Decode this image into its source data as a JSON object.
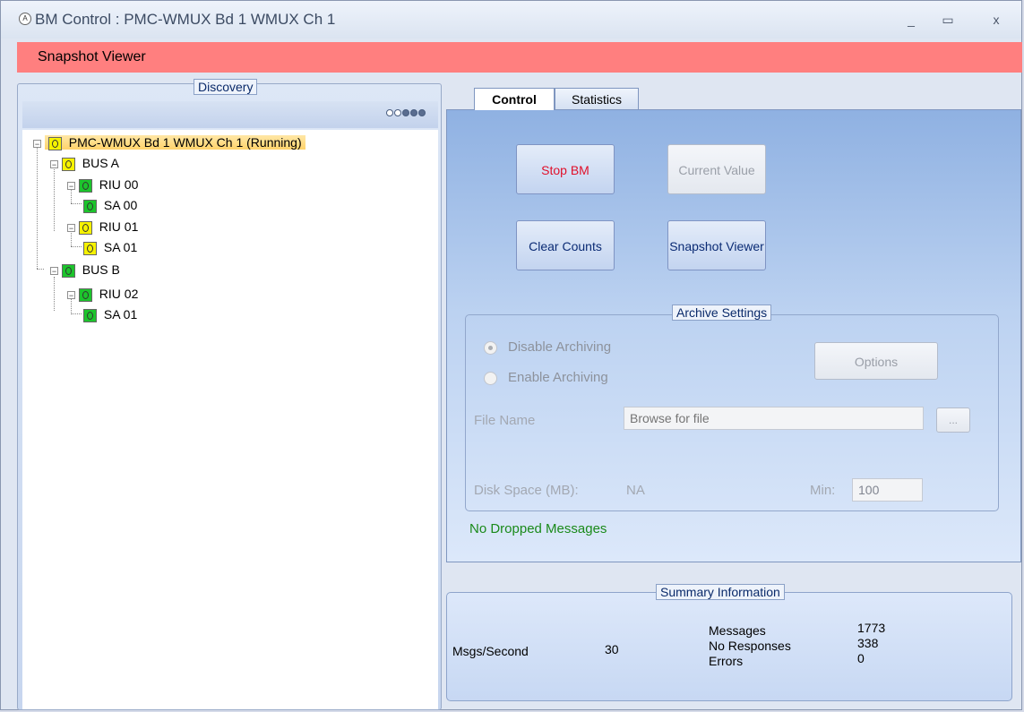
{
  "window": {
    "title": "BM Control : PMC-WMUX Bd 1 WMUX Ch 1",
    "icon": "app-icon",
    "min": "_",
    "max": "▭",
    "close": "x"
  },
  "menubar": {
    "label": "Snapshot Viewer"
  },
  "discovery": {
    "legend": "Discovery",
    "tree": {
      "root": "PMC-WMUX Bd 1 WMUX Ch 1 (Running)",
      "bus_a": "BUS A",
      "riu00": "RIU 00",
      "sa00": "SA 00",
      "riu01": "RIU 01",
      "sa01a": "SA 01",
      "bus_b": "BUS B",
      "riu02": "RIU 02",
      "sa01b": "SA 01"
    }
  },
  "tabs": {
    "control": "Control",
    "statistics": "Statistics"
  },
  "control": {
    "stop": "Stop BM",
    "current": "Current Value",
    "clear": "Clear Counts",
    "snapshot": "Snapshot Viewer"
  },
  "archive": {
    "legend": "Archive Settings",
    "disable": "Disable Archiving",
    "enable": "Enable Archiving",
    "options": "Options",
    "file_label": "File Name",
    "file_placeholder": "Browse for file",
    "browse": "...",
    "disk_label": "Disk Space (MB):",
    "disk_value": "NA",
    "min_label": "Min:",
    "min_value": "100"
  },
  "status": "No Dropped Messages",
  "summary": {
    "legend": "Summary Information",
    "msgs_label": "Msgs/Second",
    "msgs_value": "30",
    "messages_label": "Messages",
    "messages_value": "1773",
    "noresp_label": "No Responses",
    "noresp_value": "338",
    "errors_label": "Errors",
    "errors_value": "0"
  },
  "colors": {
    "menubar": "#ff7f7f",
    "stop_text": "#e0102a",
    "status_text": "#1a8a1a",
    "node_yellow": "#f6f200",
    "node_green": "#1cc42c"
  }
}
